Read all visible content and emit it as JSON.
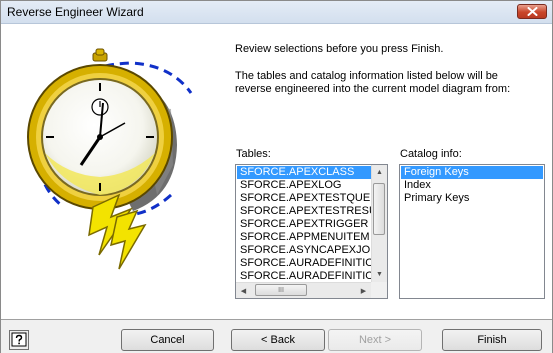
{
  "window": {
    "title": "Reverse Engineer Wizard"
  },
  "icons": {
    "close": "close-icon",
    "help": "help-icon",
    "stopwatch": "stopwatch-illustration"
  },
  "message": {
    "line1": "Review selections before you press Finish.",
    "line2": "The tables and catalog information listed below will be reverse engineered into the current model diagram from:"
  },
  "tables": {
    "label": "Tables:",
    "items": [
      "SFORCE.APEXCLASS",
      "SFORCE.APEXLOG",
      "SFORCE.APEXTESTQUEUEI",
      "SFORCE.APEXTESTRESULT",
      "SFORCE.APEXTRIGGER",
      "SFORCE.APPMENUITEM",
      "SFORCE.ASYNCAPEXJOB",
      "SFORCE.AURADEFINITION",
      "SFORCE.AURADEFINITION"
    ],
    "selected": "SFORCE.APEXCLASS"
  },
  "catalog": {
    "label": "Catalog info:",
    "items": [
      "Foreign Keys",
      "Index",
      "Primary Keys"
    ],
    "selected": "Foreign Keys"
  },
  "scroll": {
    "h_thumb_grip": "III"
  },
  "buttons": {
    "cancel": "Cancel",
    "back": "< Back",
    "next": "Next >",
    "finish": "Finish"
  },
  "colors": {
    "selection": "#3399ff",
    "footer": "#f0f0f0",
    "close": "#c9462a"
  }
}
